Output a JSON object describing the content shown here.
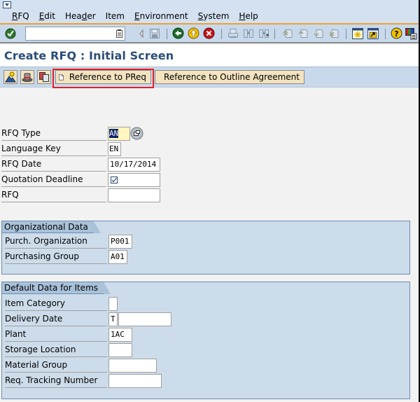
{
  "menubar": {
    "system_icon": "sap-system-menu-icon",
    "items": [
      {
        "label": "RFQ",
        "underline": "R"
      },
      {
        "label": "Edit",
        "underline": "E"
      },
      {
        "label": "Header",
        "underline": "d"
      },
      {
        "label": "Item",
        "underline": ""
      },
      {
        "label": "Environment",
        "underline": "E"
      },
      {
        "label": "System",
        "underline": "S"
      },
      {
        "label": "Help",
        "underline": "H"
      }
    ]
  },
  "toolbar": {
    "command_field": {
      "value": "",
      "placeholder": ""
    },
    "icons": [
      "enter-icon",
      "back-arrow-small-icon",
      "save-icon",
      "back-icon",
      "exit-icon",
      "cancel-icon",
      "print-icon",
      "find-icon",
      "find-next-icon",
      "first-page-icon",
      "previous-page-icon",
      "next-page-icon",
      "last-page-icon",
      "create-session-icon",
      "create-shortcut-icon",
      "help-icon",
      "customize-layout-icon"
    ]
  },
  "page": {
    "title": "Create RFQ : Initial Screen"
  },
  "app_toolbar": {
    "icons": [
      "org-data-icon",
      "header-data-icon",
      "copy-icon"
    ],
    "buttons": [
      {
        "label": "Reference to PReq",
        "highlighted": true
      },
      {
        "label": "Reference to Outline Agreement",
        "highlighted": false
      }
    ]
  },
  "form": {
    "rfq_type": {
      "label": "RFQ Type",
      "value": "AN"
    },
    "language_key": {
      "label": "Language Key",
      "value": "EN"
    },
    "rfq_date": {
      "label": "RFQ Date",
      "value": "10/17/2014"
    },
    "quotation_deadline": {
      "label": "Quotation Deadline",
      "value": "☑"
    },
    "rfq": {
      "label": "RFQ",
      "value": ""
    }
  },
  "org_data": {
    "title": "Organizational Data",
    "purch_org": {
      "label": "Purch. Organization",
      "value": "P001"
    },
    "purch_group": {
      "label": "Purchasing Group",
      "value": "A01"
    }
  },
  "default_data": {
    "title": "Default Data for Items",
    "item_category": {
      "label": "Item Category",
      "value": ""
    },
    "delivery_date": {
      "label": "Delivery Date",
      "format": "T",
      "value": ""
    },
    "plant": {
      "label": "Plant",
      "value": "1AC"
    },
    "storage_location": {
      "label": "Storage Location",
      "value": ""
    },
    "material_group": {
      "label": "Material Group",
      "value": ""
    },
    "req_tracking_number": {
      "label": "Req. Tracking Number",
      "value": ""
    }
  }
}
